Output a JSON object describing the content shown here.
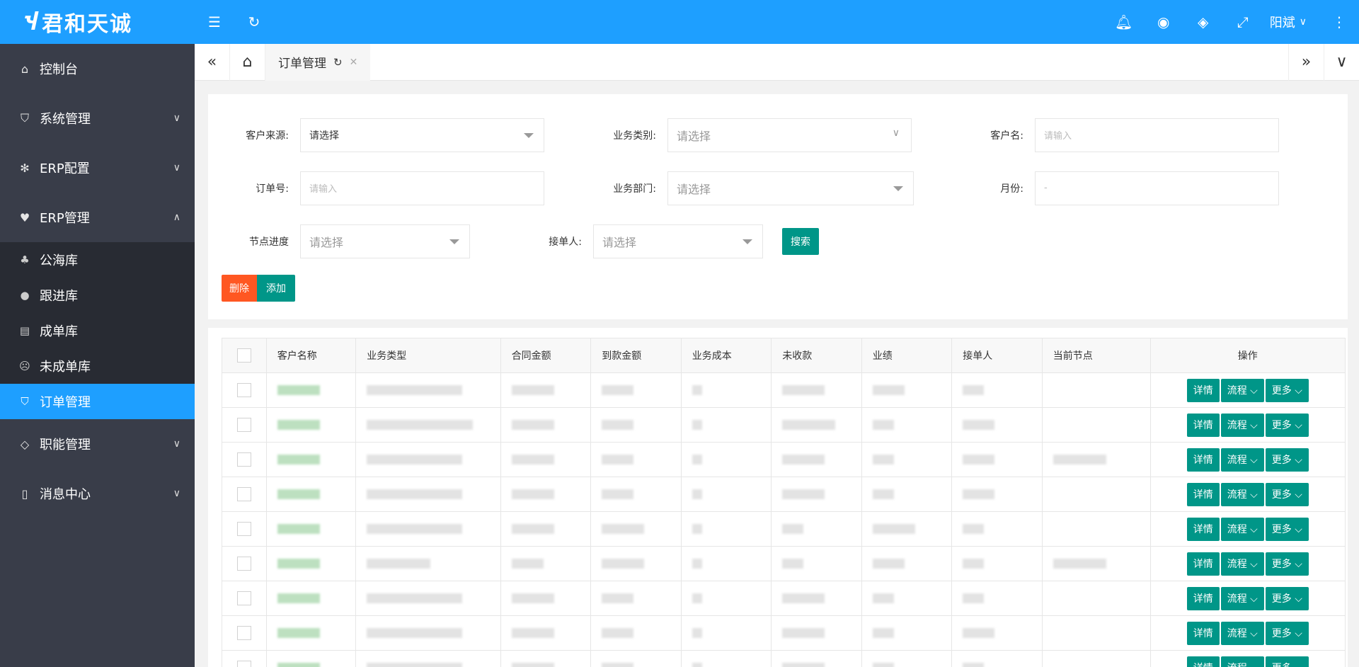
{
  "app": {
    "logo_mark": "Ⴣ",
    "logo_text": "君和天诚"
  },
  "sidebar": {
    "items": [
      {
        "label": "控制台",
        "icon": "home-icon"
      },
      {
        "label": "系统管理",
        "icon": "shield-icon",
        "arrow": "⌵"
      },
      {
        "label": "ERP配置",
        "icon": "gear-icon",
        "arrow": "⌵"
      },
      {
        "label": "ERP管理",
        "icon": "heart-icon",
        "arrow": "⌃"
      }
    ],
    "sub_items": [
      {
        "label": "公海库",
        "icon": "group-icon"
      },
      {
        "label": "跟进库",
        "icon": "chat-icon"
      },
      {
        "label": "成单库",
        "icon": "clipboard-icon"
      },
      {
        "label": "未成单库",
        "icon": "sad-face-icon"
      },
      {
        "label": "订单管理",
        "icon": "shield-check-icon",
        "active": true
      }
    ],
    "items_after": [
      {
        "label": "职能管理",
        "icon": "diamond-icon",
        "arrow": "⌵"
      },
      {
        "label": "消息中心",
        "icon": "phone-icon",
        "arrow": "⌵"
      }
    ]
  },
  "header": {
    "user_name": "阳斌"
  },
  "tabs": {
    "active_label": "订单管理"
  },
  "filters": {
    "customer_source": {
      "label": "客户来源:",
      "value": "请选择"
    },
    "business_category": {
      "label": "业务类别:",
      "placeholder": "请选择"
    },
    "customer_name": {
      "label": "客户名:",
      "placeholder": "请输入"
    },
    "order_no": {
      "label": "订单号:",
      "placeholder": "请输入"
    },
    "business_dept": {
      "label": "业务部门:",
      "placeholder": "请选择"
    },
    "month": {
      "label": "月份:",
      "placeholder": "-"
    },
    "node_progress": {
      "label": "节点进度",
      "placeholder": "请选择"
    },
    "receiver": {
      "label": "接单人:",
      "placeholder": "请选择"
    },
    "search_label": "搜索"
  },
  "actions": {
    "delete_label": "删除",
    "add_label": "添加"
  },
  "table": {
    "columns": [
      "客户名称",
      "业务类型",
      "合同金额",
      "到款金额",
      "业务成本",
      "未收款",
      "业绩",
      "接单人",
      "当前节点",
      "操作"
    ],
    "row_buttons": {
      "detail": "详情",
      "flow": "流程 ⌵",
      "more": "更多 ⌵"
    },
    "row_count": 9
  }
}
